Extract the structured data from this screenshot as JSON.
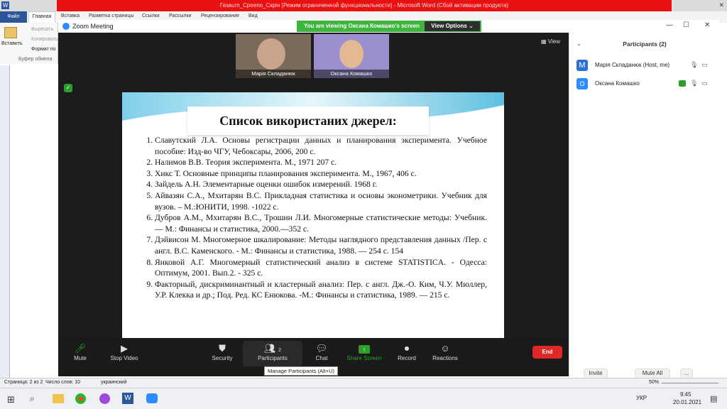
{
  "word": {
    "title": "Гезаurn_Сpeeno_Скрін [Режим ограниченной функциональности] - Microsoft Word (Сбой активации продукта)",
    "tabs": [
      "Файл",
      "Главная",
      "Вставка",
      "Разметка страницы",
      "Ссылки",
      "Рассылки",
      "Рецензирование",
      "Вид"
    ],
    "clipboard": {
      "paste": "Вставить",
      "cut": "Вырезать",
      "copy": "Копировать",
      "format": "Формат по",
      "group": "Буфер обмена"
    },
    "status": {
      "page": "Страница: 2 из 2",
      "words": "Число слов: 10",
      "lang": "украинский",
      "zoom": "50%"
    }
  },
  "zoom": {
    "title": "Zoom Meeting",
    "banner": "You are viewing Оксана Комашко's screen",
    "view_options": "View Options",
    "view": "View",
    "participants_thumbs": [
      {
        "name": "Марія Складанюк"
      },
      {
        "name": "Оксана Комашко"
      }
    ],
    "toolbar": {
      "mute": "Mute",
      "stop_video": "Stop Video",
      "security": "Security",
      "participants": "Participants",
      "participants_count": "2",
      "chat": "Chat",
      "share": "Share Screen",
      "record": "Record",
      "reactions": "Reactions",
      "end": "End"
    },
    "tooltip": "Manage Participants (Alt+U)"
  },
  "panel": {
    "title": "Participants (2)",
    "list": [
      {
        "initial": "M",
        "name": "Марія Складанюк (Host, me)"
      },
      {
        "initial": "О",
        "name": "Оксана Комашко"
      }
    ],
    "invite": "Invite",
    "mute_all": "Mute All",
    "more": "..."
  },
  "slide": {
    "title": "Список використаних джерел:",
    "refs": [
      "Славутский Л.А. Основы регистрации данных и планирования эксперимента. Учебное пособие: Изд-во ЧГУ, Чебоксары, 2006, 200 с.",
      "Налимов В.В. Теория эксперимента. М., 1971 207 с.",
      "Хикс Т. Основные принципы планирования эксперимента. М., 1967, 406 с.",
      "Зайдель А.Н. Элементарные оценки ошибок измерений. 1968 г.",
      "Айвазян С.А., Мхитарян В.С. Прикладная статистика и основы эконометрики. Учебник для вузов. – М.:ЮНИТИ, 1998. -1022 с.",
      "Дубров А.М., Мхитарян В.С., Трошин Л.И. Многомерные статистические методы: Учебник. — М.: Финансы и статистика, 2000.—352 с.",
      "Дэйвисон М. Многомерное шкалирование: Методы наглядного представления данных /Пер. с англ. В.С. Каменского. - М.: Финансы и статистика, 1988. — 254 с. 154",
      "Янковой А.Г. Многомерный статистический анализ в системе STATISTICA. - Одесса: Оптимум, 2001. Вып.2. - 325 с.",
      "Факторный, дискриминантный и кластерный анализ: Пер. с англ. Дж.-О. Ким, Ч.У. Мюллер, У.Р. Клекка и др.; Под. Ред. КС Енюкова. -М.: Финансы и статистика, 1989. — 215 с."
    ]
  },
  "taskbar": {
    "time": "9:45",
    "date": "20.01.2021",
    "lang": "УКР"
  },
  "colors": {
    "zoom_blue": "#2d8cff",
    "end_red": "#e02828",
    "banner_green": "#3fb53f",
    "word_red": "#e81010"
  }
}
